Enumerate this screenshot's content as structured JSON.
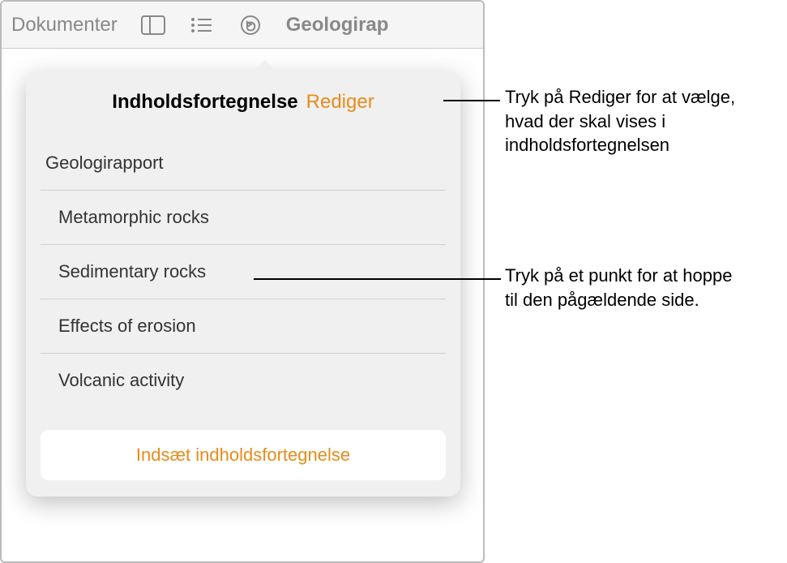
{
  "toolbar": {
    "documents_label": "Dokumenter",
    "doc_title": "Geologirap"
  },
  "popover": {
    "title": "Indholdsfortegnelse",
    "edit_label": "Rediger",
    "toc_items": [
      {
        "label": "Geologirapport",
        "level": 1
      },
      {
        "label": "Metamorphic rocks",
        "level": 2
      },
      {
        "label": "Sedimentary rocks",
        "level": 2
      },
      {
        "label": "Effects of erosion",
        "level": 2
      },
      {
        "label": "Volcanic activity",
        "level": 2
      }
    ],
    "insert_label": "Indsæt indholdsfortegnelse"
  },
  "callouts": {
    "c1": "Tryk på Rediger for at vælge, hvad der skal vises i indholdsfortegnelsen",
    "c2": "Tryk på et punkt for at hoppe til den pågældende side."
  }
}
